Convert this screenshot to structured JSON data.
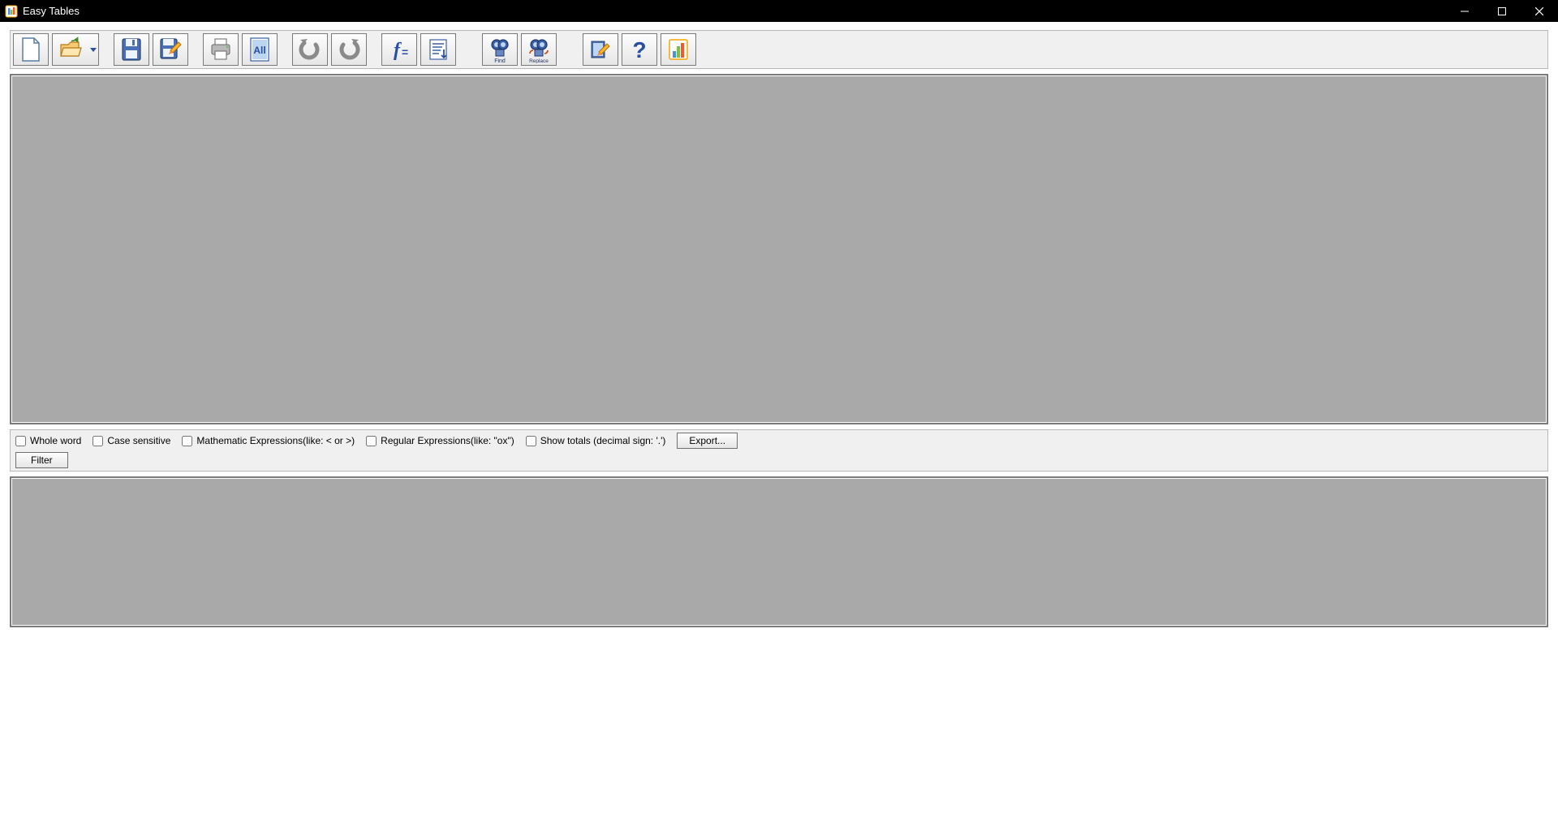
{
  "title": "Easy Tables",
  "toolbar": {
    "new": "New",
    "open": "Open",
    "save": "Save",
    "saveas": "Save As",
    "print": "Print",
    "selectall": "Select All",
    "undo": "Undo",
    "redo": "Redo",
    "formula": "Formula",
    "sort": "Sort",
    "find": "Find",
    "replace": "Replace",
    "settings": "Settings",
    "help": "Help",
    "chart": "Chart"
  },
  "filters": {
    "whole_word": "Whole word",
    "case_sensitive": "Case sensitive",
    "math_expr": "Mathematic Expressions(like: < or >)",
    "regex": "Regular Expressions(like: \"ox\")",
    "show_totals": "Show totals (decimal sign: '.')",
    "export": "Export...",
    "filter": "Filter"
  }
}
